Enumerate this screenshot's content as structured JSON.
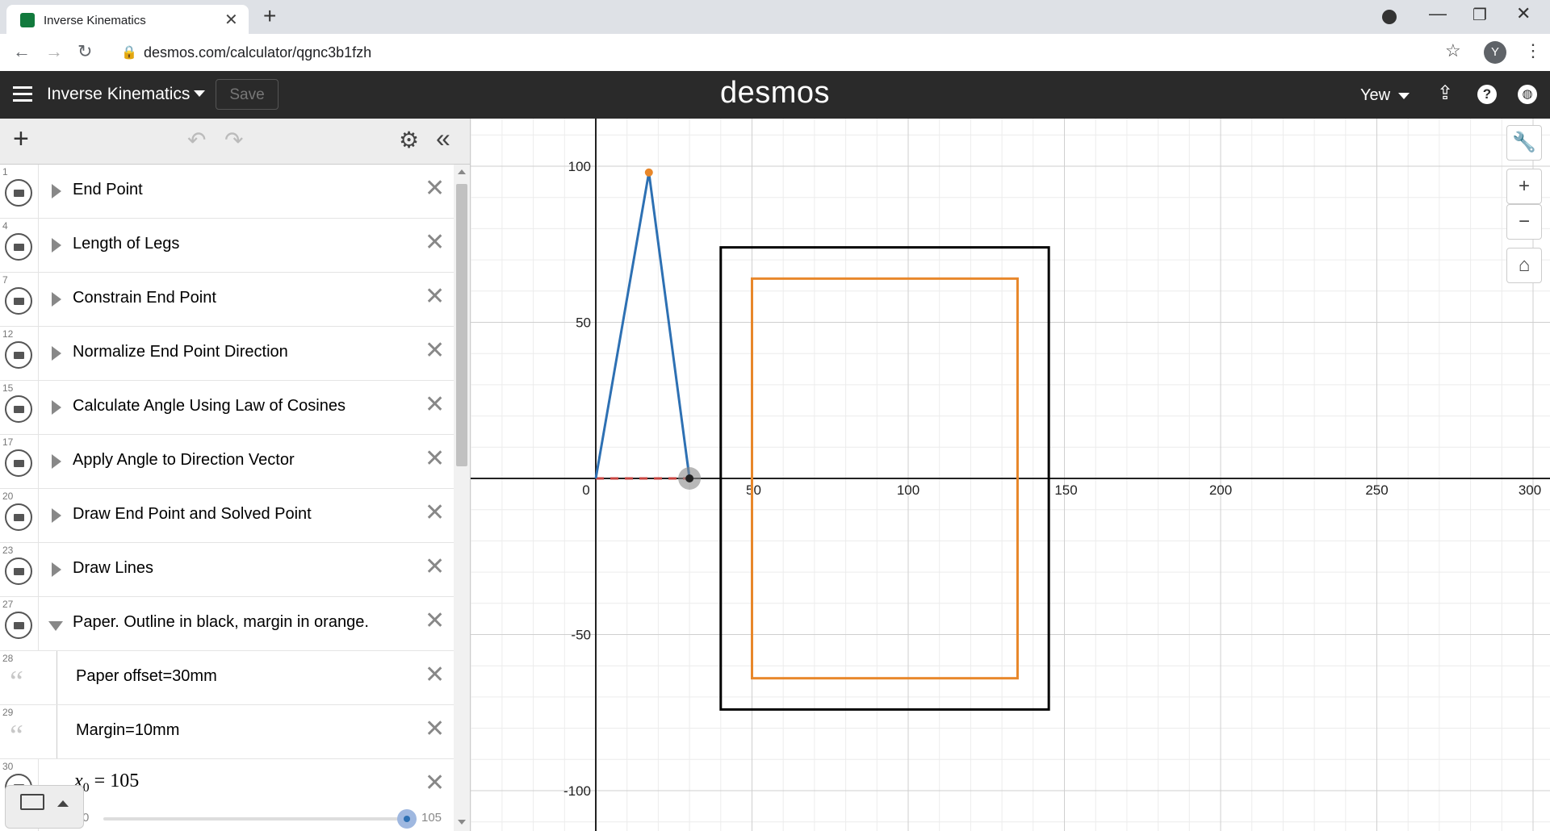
{
  "browser": {
    "tab_title": "Inverse Kinematics",
    "new_tab": "+",
    "url": "desmos.com/calculator/qgnc3b1fzh",
    "profile_initial": "Y"
  },
  "header": {
    "graph_title": "Inverse Kinematics",
    "save_label": "Save",
    "logo": "desmos",
    "user_name": "Yew"
  },
  "expressions": [
    {
      "num": "1",
      "label": "End Point",
      "kind": "folder"
    },
    {
      "num": "4",
      "label": "Length of Legs",
      "kind": "folder"
    },
    {
      "num": "7",
      "label": "Constrain End Point",
      "kind": "folder"
    },
    {
      "num": "12",
      "label": "Normalize End Point Direction",
      "kind": "folder"
    },
    {
      "num": "15",
      "label": "Calculate Angle Using Law of Cosines",
      "kind": "folder"
    },
    {
      "num": "17",
      "label": "Apply Angle to Direction Vector",
      "kind": "folder"
    },
    {
      "num": "20",
      "label": "Draw End Point and Solved Point",
      "kind": "folder"
    },
    {
      "num": "23",
      "label": "Draw Lines",
      "kind": "folder"
    },
    {
      "num": "27",
      "label": "Paper. Outline in black, margin in orange.",
      "kind": "folder-open"
    },
    {
      "num": "28",
      "label": "Paper offset=30mm",
      "kind": "note"
    },
    {
      "num": "29",
      "label": "Margin=10mm",
      "kind": "note"
    },
    {
      "num": "30",
      "label": "x",
      "kind": "slider",
      "subscript": "0",
      "equals": "= 105",
      "min": "0",
      "max": "105",
      "value": 105
    }
  ],
  "graph": {
    "x_ticks": [
      "50",
      "100",
      "150",
      "200",
      "250",
      "300"
    ],
    "y_ticks": [
      "100",
      "50",
      "-50",
      "-100"
    ],
    "origin_label": "0",
    "colors": {
      "blue": "#2d70b3",
      "orange": "#e8872a",
      "black": "#000000",
      "red": "#c74440"
    }
  },
  "icons": {
    "menu": "hamburger-icon",
    "add": "plus-icon",
    "undo": "undo-icon",
    "redo": "redo-icon",
    "settings": "gear-icon",
    "collapse": "double-chevron-left-icon",
    "wrench": "wrench-icon",
    "zoom_in": "plus-icon",
    "zoom_out": "minus-icon",
    "home": "home-icon"
  }
}
